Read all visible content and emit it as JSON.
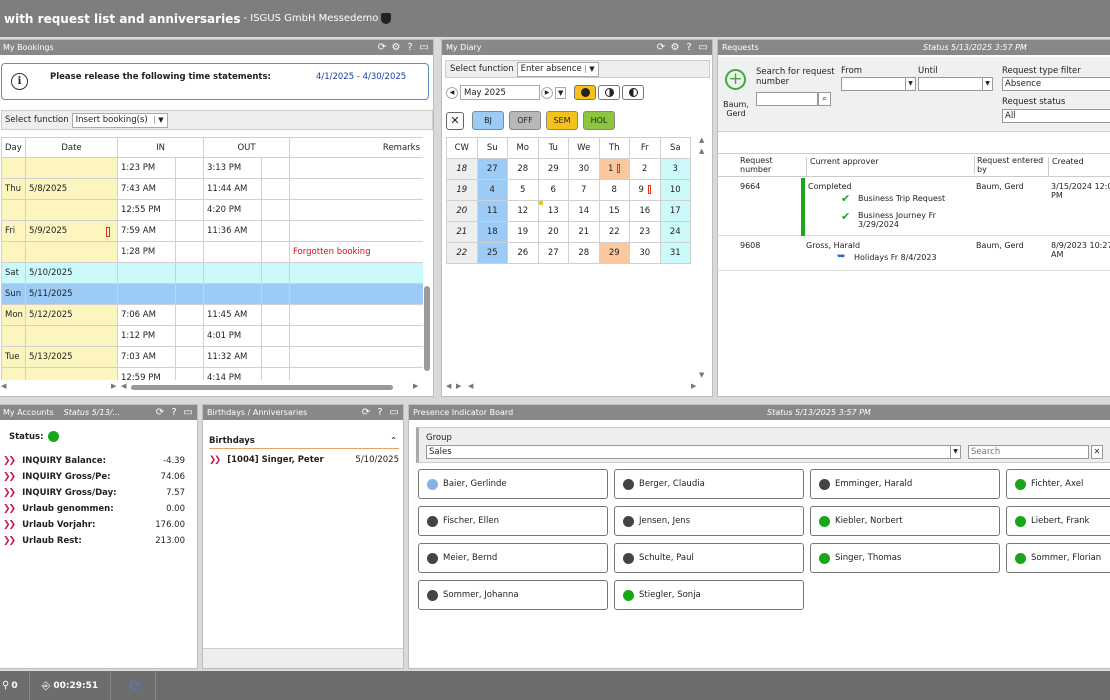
{
  "title": {
    "main": "with request list and anniversaries",
    "sub": "- ISGUS GmbH Messedemo"
  },
  "bookings": {
    "title": "My Bookings",
    "notice": "Please release the following time statements:",
    "period": "4/1/2025 - 4/30/2025",
    "select_label": "Select function",
    "select_value": "Insert booking(s)",
    "headers": [
      "Day",
      "Date",
      "IN",
      "OUT",
      "Remarks"
    ],
    "rows": [
      {
        "day": "",
        "date": "",
        "in": "1:23 PM",
        "out": "3:13 PM",
        "rem": "",
        "cls": "yel",
        "flag": false
      },
      {
        "day": "Thu",
        "date": "5/8/2025",
        "in": "7:43 AM",
        "out": "11:44 AM",
        "rem": "",
        "cls": "yel",
        "flag": false
      },
      {
        "day": "",
        "date": "",
        "in": "12:55 PM",
        "out": "4:20 PM",
        "rem": "",
        "cls": "yel",
        "flag": false
      },
      {
        "day": "Fri",
        "date": "5/9/2025",
        "in": "7:59 AM",
        "out": "11:36 AM",
        "rem": "",
        "cls": "yel",
        "flag": true
      },
      {
        "day": "",
        "date": "",
        "in": "1:28 PM",
        "out": "",
        "rem": "Forgotten booking",
        "cls": "yel",
        "flag": false
      },
      {
        "day": "Sat",
        "date": "5/10/2025",
        "in": "",
        "out": "",
        "rem": "",
        "cls": "cyan",
        "flag": false
      },
      {
        "day": "Sun",
        "date": "5/11/2025",
        "in": "",
        "out": "",
        "rem": "",
        "cls": "blue",
        "flag": false
      },
      {
        "day": "Mon",
        "date": "5/12/2025",
        "in": "7:06 AM",
        "out": "11:45 AM",
        "rem": "",
        "cls": "yel",
        "flag": false
      },
      {
        "day": "",
        "date": "",
        "in": "1:12 PM",
        "out": "4:01 PM",
        "rem": "",
        "cls": "yel",
        "flag": false
      },
      {
        "day": "Tue",
        "date": "5/13/2025",
        "in": "7:03 AM",
        "out": "11:32 AM",
        "rem": "",
        "cls": "yel",
        "flag": false
      },
      {
        "day": "",
        "date": "",
        "in": "12:59 PM",
        "out": "4:14 PM",
        "rem": "",
        "cls": "yel",
        "flag": false
      }
    ]
  },
  "diary": {
    "title": "My Diary",
    "select_label": "Select function",
    "select_value": "Enter absence",
    "month": "May 2025",
    "buttons": [
      "BJ",
      "OFF",
      "SEM",
      "HOL"
    ],
    "button_colors": [
      "#9cccf6",
      "#b8b8b8",
      "#f7c11c",
      "#8cc63f"
    ],
    "headers": [
      "CW",
      "Su",
      "Mo",
      "Tu",
      "We",
      "Th",
      "Fr",
      "Sa"
    ],
    "weeks": [
      {
        "cw": "18",
        "days": [
          "27",
          "28",
          "29",
          "30",
          "1",
          "2",
          "3"
        ]
      },
      {
        "cw": "19",
        "days": [
          "4",
          "5",
          "6",
          "7",
          "8",
          "9",
          "10"
        ]
      },
      {
        "cw": "20",
        "days": [
          "11",
          "12",
          "13",
          "14",
          "15",
          "16",
          "17"
        ]
      },
      {
        "cw": "21",
        "days": [
          "18",
          "19",
          "20",
          "21",
          "22",
          "23",
          "24"
        ]
      },
      {
        "cw": "22",
        "days": [
          "25",
          "26",
          "27",
          "28",
          "29",
          "30",
          "31"
        ]
      }
    ]
  },
  "requests": {
    "title": "Requests",
    "status": "Status 5/13/2025 3:57 PM",
    "user": "Baum, Gerd",
    "search_label": "Search for request number",
    "from_label": "From",
    "until_label": "Until",
    "type_label": "Request type filter",
    "type_value": "Absence",
    "status_label": "Request status",
    "status_value": "All",
    "headers": [
      "Request number",
      "Current approver",
      "Request entered by",
      "Created"
    ],
    "rows": [
      {
        "num": "9664",
        "approver": "Completed",
        "by": "Baum, Gerd",
        "created": "3/15/2024 12:0 PM",
        "items": [
          "Business Trip Request",
          "Business Journey Fr 3/29/2024"
        ]
      },
      {
        "num": "9608",
        "approver": "Gross, Harald",
        "by": "Baum, Gerd",
        "created": "8/9/2023 10:27 AM",
        "items": [
          "Holidays Fr 8/4/2023"
        ]
      }
    ]
  },
  "accounts": {
    "title": "My Accounts",
    "status": "Status 5/13/...",
    "status_label": "Status:",
    "rows": [
      {
        "label": "INQUIRY Balance:",
        "value": "-4.39"
      },
      {
        "label": "INQUIRY Gross/Pe:",
        "value": "74.06"
      },
      {
        "label": "INQUIRY Gross/Day:",
        "value": "7.57"
      },
      {
        "label": "Urlaub genommen:",
        "value": "0.00"
      },
      {
        "label": "Urlaub Vorjahr:",
        "value": "176.00"
      },
      {
        "label": "Urlaub Rest:",
        "value": "213.00"
      }
    ]
  },
  "birthdays": {
    "title": "Birthdays / Anniversaries",
    "section": "Birthdays",
    "entry_name": "[1004] Singer, Peter",
    "entry_date": "5/10/2025"
  },
  "presence": {
    "title": "Presence Indicator Board",
    "status": "Status 5/13/2025 3:57 PM",
    "group_label": "Group",
    "group_value": "Sales",
    "search_placeholder": "Search",
    "people": [
      {
        "name": "Baier, Gerlinde",
        "state": "l"
      },
      {
        "name": "Berger, Claudia",
        "state": "d"
      },
      {
        "name": "Emminger, Harald",
        "state": "d"
      },
      {
        "name": "Fichter, Axel",
        "state": "g"
      },
      {
        "name": "Fischer, Ellen",
        "state": "d"
      },
      {
        "name": "Jensen, Jens",
        "state": "d"
      },
      {
        "name": "Kiebler, Norbert",
        "state": "g"
      },
      {
        "name": "Liebert, Frank",
        "state": "g"
      },
      {
        "name": "Meier, Bernd",
        "state": "d"
      },
      {
        "name": "Schulte, Paul",
        "state": "d"
      },
      {
        "name": "Singer, Thomas",
        "state": "g"
      },
      {
        "name": "Sommer, Florian",
        "state": "g"
      },
      {
        "name": "Sommer, Johanna",
        "state": "d"
      },
      {
        "name": "Stiegler, Sonja",
        "state": "g"
      }
    ]
  },
  "footer": {
    "count": "0",
    "timer": "00:29:51"
  }
}
